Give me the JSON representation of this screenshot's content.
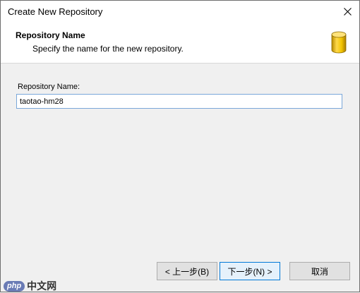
{
  "window": {
    "title": "Create New Repository"
  },
  "banner": {
    "title": "Repository Name",
    "subtitle": "Specify the name for the new repository.",
    "icon": "database-icon"
  },
  "form": {
    "label": "Repository Name:",
    "value": "taotao-hm28"
  },
  "buttons": {
    "back": "< 上一步(B)",
    "next": "下一步(N) >",
    "cancel": "取消"
  },
  "watermark": {
    "badge": "php",
    "text": "中文网"
  },
  "colors": {
    "accent": "#0078d7",
    "input_border": "#7aa7d9",
    "db_icon": "#f2c400"
  }
}
